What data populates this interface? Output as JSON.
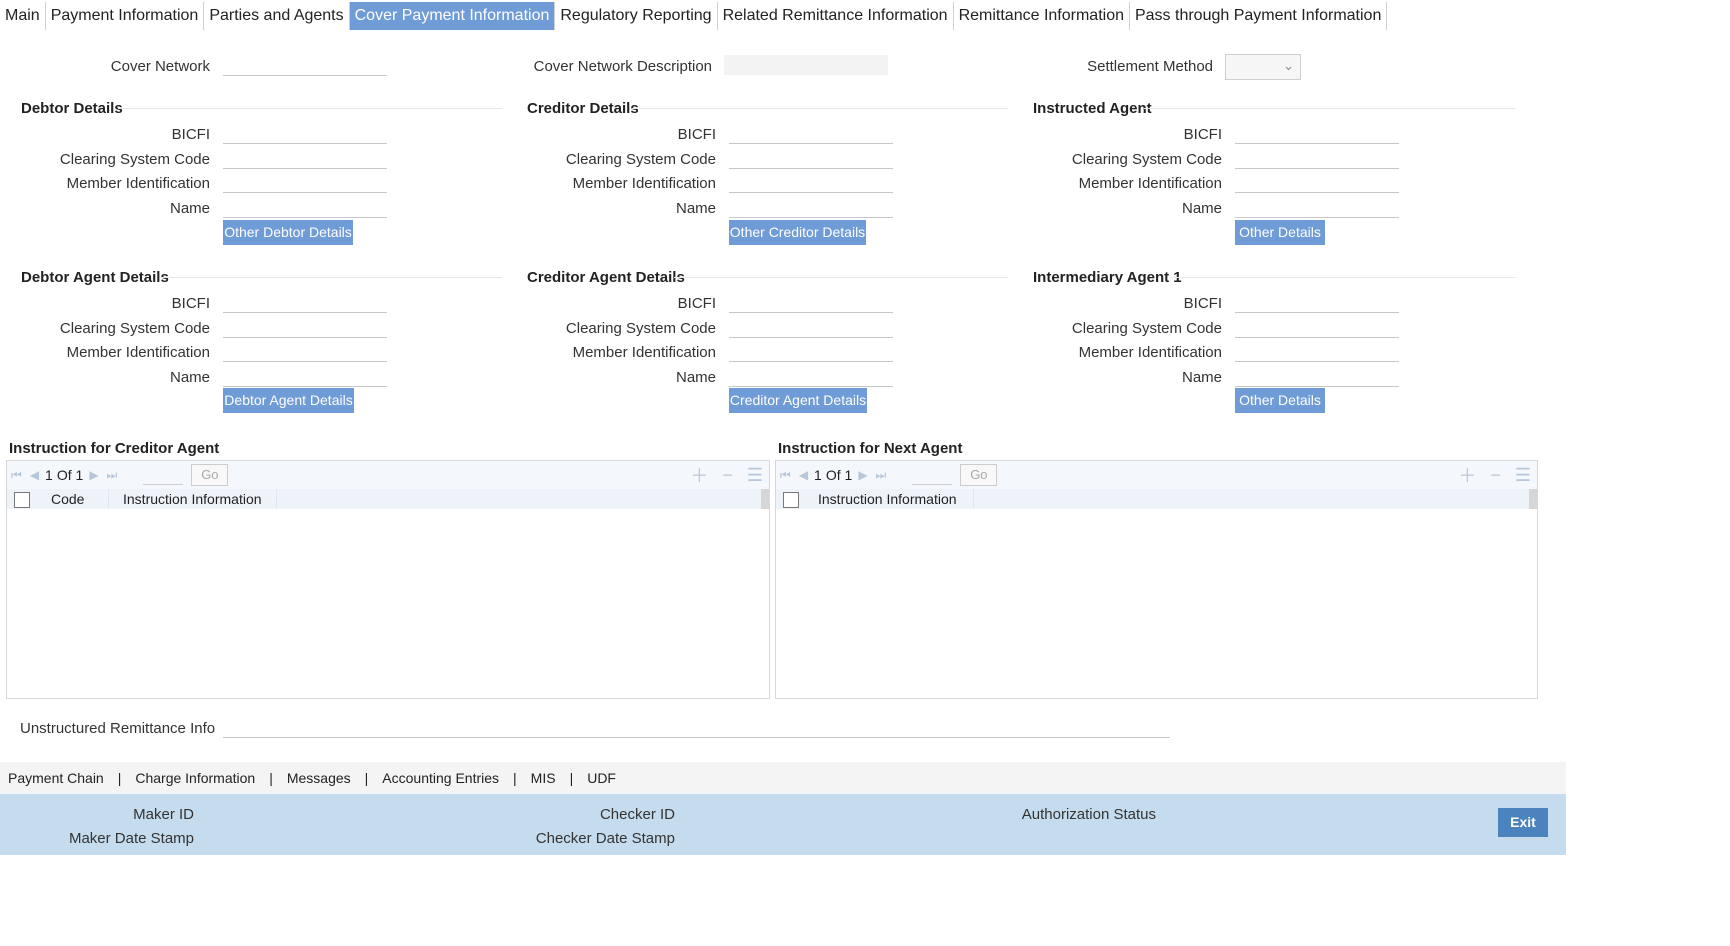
{
  "tabs": [
    {
      "label": "Main",
      "active": false
    },
    {
      "label": "Payment Information",
      "active": false
    },
    {
      "label": "Parties and Agents",
      "active": false
    },
    {
      "label": "Cover Payment Information",
      "active": true
    },
    {
      "label": "Regulatory Reporting",
      "active": false
    },
    {
      "label": "Related Remittance Information",
      "active": false
    },
    {
      "label": "Remittance Information",
      "active": false
    },
    {
      "label": "Pass through Payment Information",
      "active": false
    }
  ],
  "top": {
    "cover_network_label": "Cover Network",
    "cover_network_value": "",
    "cover_network_desc_label": "Cover Network Description",
    "cover_network_desc_value": "",
    "settlement_method_label": "Settlement Method",
    "settlement_method_value": ""
  },
  "field_labels": {
    "bicfi": "BICFI",
    "clearing": "Clearing System Code",
    "member": "Member Identification",
    "name": "Name"
  },
  "sections": {
    "debtor": {
      "title": "Debtor Details",
      "button": "Other Debtor Details"
    },
    "creditor": {
      "title": "Creditor Details",
      "button": "Other Creditor Details"
    },
    "instructed": {
      "title": "Instructed Agent",
      "button": "Other Details"
    },
    "debtor_agent": {
      "title": "Debtor Agent Details",
      "button": "Debtor Agent Details"
    },
    "creditor_agent": {
      "title": "Creditor Agent Details",
      "button": "Creditor Agent Details"
    },
    "intermediary": {
      "title": "Intermediary Agent 1",
      "button": "Other Details"
    }
  },
  "grids": {
    "creditor_agent": {
      "title": "Instruction for Creditor Agent",
      "page": "1",
      "of": "Of 1",
      "go": "Go",
      "columns": [
        "Code",
        "Instruction Information"
      ]
    },
    "next_agent": {
      "title": "Instruction for Next Agent",
      "page": "1",
      "of": "Of 1",
      "go": "Go",
      "columns": [
        "Instruction Information"
      ]
    }
  },
  "remittance": {
    "label": "Unstructured Remittance Info",
    "value": ""
  },
  "footer_links": [
    "Payment Chain",
    "Charge Information",
    "Messages",
    "Accounting Entries",
    "MIS",
    "UDF"
  ],
  "audit": {
    "maker_id": "Maker ID",
    "maker_date": "Maker Date Stamp",
    "checker_id": "Checker ID",
    "checker_date": "Checker Date Stamp",
    "auth_status": "Authorization Status",
    "exit": "Exit"
  }
}
